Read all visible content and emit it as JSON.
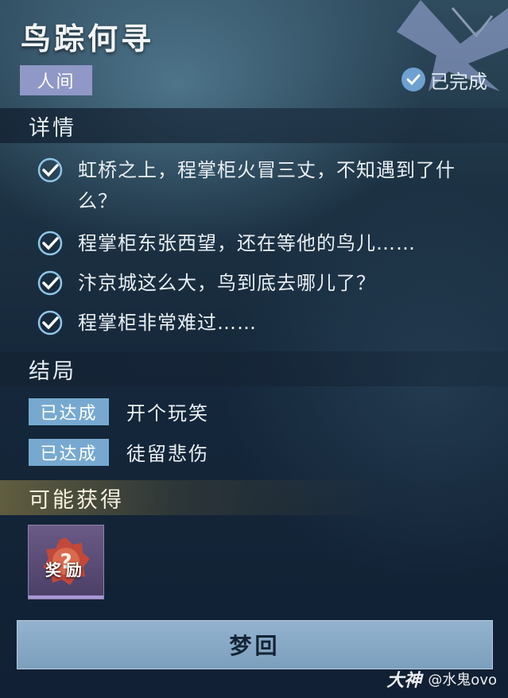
{
  "quest": {
    "title": "鸟踪何寻",
    "category": "人间",
    "status": "已完成"
  },
  "details": {
    "heading": "详情",
    "items": [
      "虹桥之上，程掌柜火冒三丈，不知遇到了什么？",
      "程掌柜东张西望，还在等他的鸟儿……",
      "汴京城这么大，鸟到底去哪儿了？",
      "程掌柜非常难过……"
    ]
  },
  "endings": {
    "heading": "结局",
    "items": [
      {
        "badge": "已达成",
        "name": "开个玩笑"
      },
      {
        "badge": "已达成",
        "name": "徒留悲伤"
      }
    ]
  },
  "rewards": {
    "heading": "可能获得",
    "items": [
      {
        "label": "奖励",
        "icon": "mystery-reward-icon"
      }
    ]
  },
  "action": {
    "label": "梦回"
  },
  "watermark": {
    "logo": "大神",
    "user": "@水鬼ovo"
  },
  "colors": {
    "category_tag": "#8f98c6",
    "ending_badge": "#77a9d0",
    "check_accent": "#8ec6e8",
    "button": "#8aaac7"
  }
}
